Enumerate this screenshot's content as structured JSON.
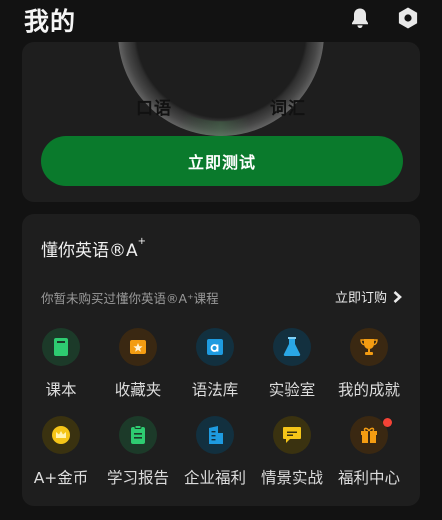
{
  "header": {
    "title": "我的",
    "icons": [
      "bell-icon",
      "settings-icon"
    ]
  },
  "gauge": {
    "labels": [
      "口语",
      "词汇"
    ]
  },
  "test_button": {
    "label": "立即测试",
    "color": "#0a7a2c"
  },
  "product": {
    "title": "懂你英语®A",
    "title_sup": "+",
    "notice": "你暂未购买过懂你英语®A⁺课程",
    "subscribe_label": "立即订购"
  },
  "grid": [
    {
      "label": "课本",
      "icon": "book-icon",
      "bg": "#1c3a29",
      "color": "#2ecc71"
    },
    {
      "label": "收藏夹",
      "icon": "star-folder-icon",
      "bg": "#3a2812",
      "color": "#f39c12"
    },
    {
      "label": "语法库",
      "icon": "grammar-a-icon",
      "bg": "#12303f",
      "color": "#1e9be0"
    },
    {
      "label": "实验室",
      "icon": "flask-icon",
      "bg": "#13303f",
      "color": "#2aa7e6"
    },
    {
      "label": "我的成就",
      "icon": "trophy-icon",
      "bg": "#3a2812",
      "color": "#f39c12"
    },
    {
      "label": "A+金币",
      "icon": "crown-coin-icon",
      "bg": "#3a3210",
      "color": "#f5c518"
    },
    {
      "label": "学习报告",
      "icon": "report-icon",
      "bg": "#1c3a29",
      "color": "#2ecc71"
    },
    {
      "label": "企业福利",
      "icon": "building-icon",
      "bg": "#12303f",
      "color": "#1e9be0"
    },
    {
      "label": "情景实战",
      "icon": "chat-icon",
      "bg": "#3a3210",
      "color": "#f5c518"
    },
    {
      "label": "福利中心",
      "icon": "gift-icon",
      "bg": "#3a2812",
      "color": "#f39c12",
      "badge": true
    }
  ]
}
